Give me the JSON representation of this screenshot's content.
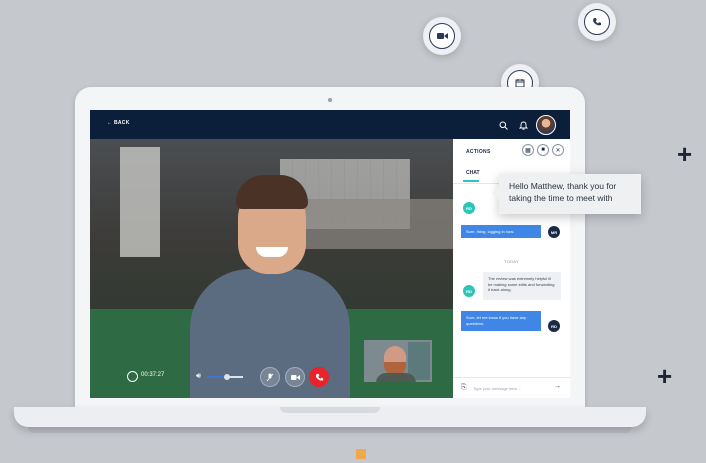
{
  "topbar": {
    "back_label": "← BACK"
  },
  "call": {
    "timer": "00:37:27",
    "volume_level": 0.55
  },
  "panel": {
    "title": "ACTIONS",
    "tab": "CHAT",
    "messages": [
      {
        "badge": "RD",
        "text": ""
      },
      {
        "badge": "MR",
        "text": "Sure, thing, logging in now."
      },
      {
        "badge": "RD",
        "text": "The review was extremely helpful ill be making some edits and forwarding it back along."
      },
      {
        "badge": "RD",
        "text": "Sure, let me know if you have any questions."
      }
    ],
    "divider": "TODAY",
    "input_placeholder": "Type your message here ..."
  },
  "tooltip": {
    "text": "Hello Matthew, thank you for taking the time to meet with"
  },
  "colors": {
    "topbar": "#0b1f3a",
    "accent_teal": "#2ec4b6",
    "bubble_blue": "#3f86e6",
    "end_call": "#e8232b"
  }
}
